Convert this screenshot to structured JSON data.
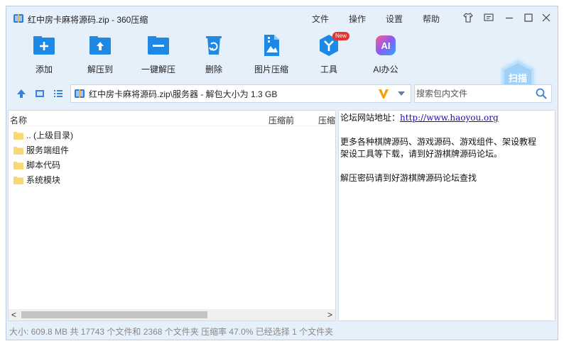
{
  "titlebar": {
    "title": "红中房卡麻将源码.zip - 360压缩",
    "menus": [
      "文件",
      "操作",
      "设置",
      "帮助"
    ],
    "buttons": [
      "shirt-icon",
      "feedback-icon",
      "minimize-icon",
      "maximize-icon",
      "close-icon"
    ]
  },
  "toolbar": {
    "tools": [
      {
        "label": "添加",
        "icon": "add-icon"
      },
      {
        "label": "解压到",
        "icon": "extract-to-icon"
      },
      {
        "label": "一键解压",
        "icon": "one-click-extract-icon"
      },
      {
        "label": "删除",
        "icon": "delete-icon"
      },
      {
        "label": "图片压缩",
        "icon": "image-compress-icon"
      },
      {
        "label": "工具",
        "icon": "tools-icon",
        "badge": "New"
      },
      {
        "label": "AI办公",
        "icon": "ai-office-icon",
        "icon_text": "AI"
      }
    ],
    "scan_label": "扫描"
  },
  "addressbar": {
    "path": "红中房卡麻将源码.zip\\服务器 - 解包大小为 1.3 GB",
    "search_placeholder": "搜索包内文件"
  },
  "filelist": {
    "columns": [
      "名称",
      "压缩前",
      "压缩"
    ],
    "rows": [
      {
        "name": ".. (上级目录)"
      },
      {
        "name": "服务端组件"
      },
      {
        "name": "脚本代码"
      },
      {
        "name": "系统模块"
      }
    ],
    "scroll_left": "<",
    "scroll_right": ">"
  },
  "comment": {
    "line1_label": "论坛网站地址：",
    "line1_link": "http://www.haoyou.org",
    "line2": "更多各种棋牌源码、游戏源码、游戏组件、架设教程",
    "line3": "架设工具等下载，请到好游棋牌源码论坛。",
    "line4": "解压密码请到好游棋牌源码论坛查找"
  },
  "statusbar": {
    "text": "大小: 609.8 MB 共 17743 个文件和 2368 个文件夹 压缩率 47.0% 已经选择 1 个文件夹"
  },
  "colors": {
    "accent": "#1e88e5",
    "window_bg": "#e6f0fb",
    "link": "#1a0dab",
    "folder": "#f8d775",
    "badge": "#e3342f"
  }
}
